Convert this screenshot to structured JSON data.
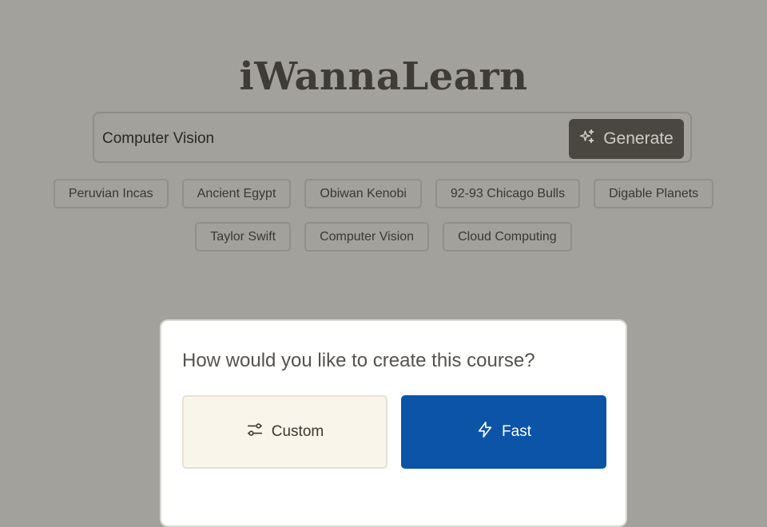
{
  "header": {
    "logo_text": "iWannaLearn"
  },
  "search": {
    "value": "Computer Vision",
    "generate_label": "Generate",
    "generate_icon": "sparkles-icon"
  },
  "suggestions": {
    "row1": [
      "Peruvian Incas",
      "Ancient Egypt",
      "Obiwan Kenobi",
      "92-93 Chicago Bulls",
      "Digable Planets"
    ],
    "row2": [
      "Taylor Swift",
      "Computer Vision",
      "Cloud Computing"
    ]
  },
  "modal": {
    "title": "How would you like to create this course?",
    "custom_label": "Custom",
    "custom_icon": "sliders-icon",
    "fast_label": "Fast",
    "fast_icon": "lightning-icon"
  },
  "colors": {
    "background": "#a3a19c",
    "generate_button": "#4a4741",
    "fast_button": "#0b54a8",
    "custom_button": "#faf5ea"
  }
}
